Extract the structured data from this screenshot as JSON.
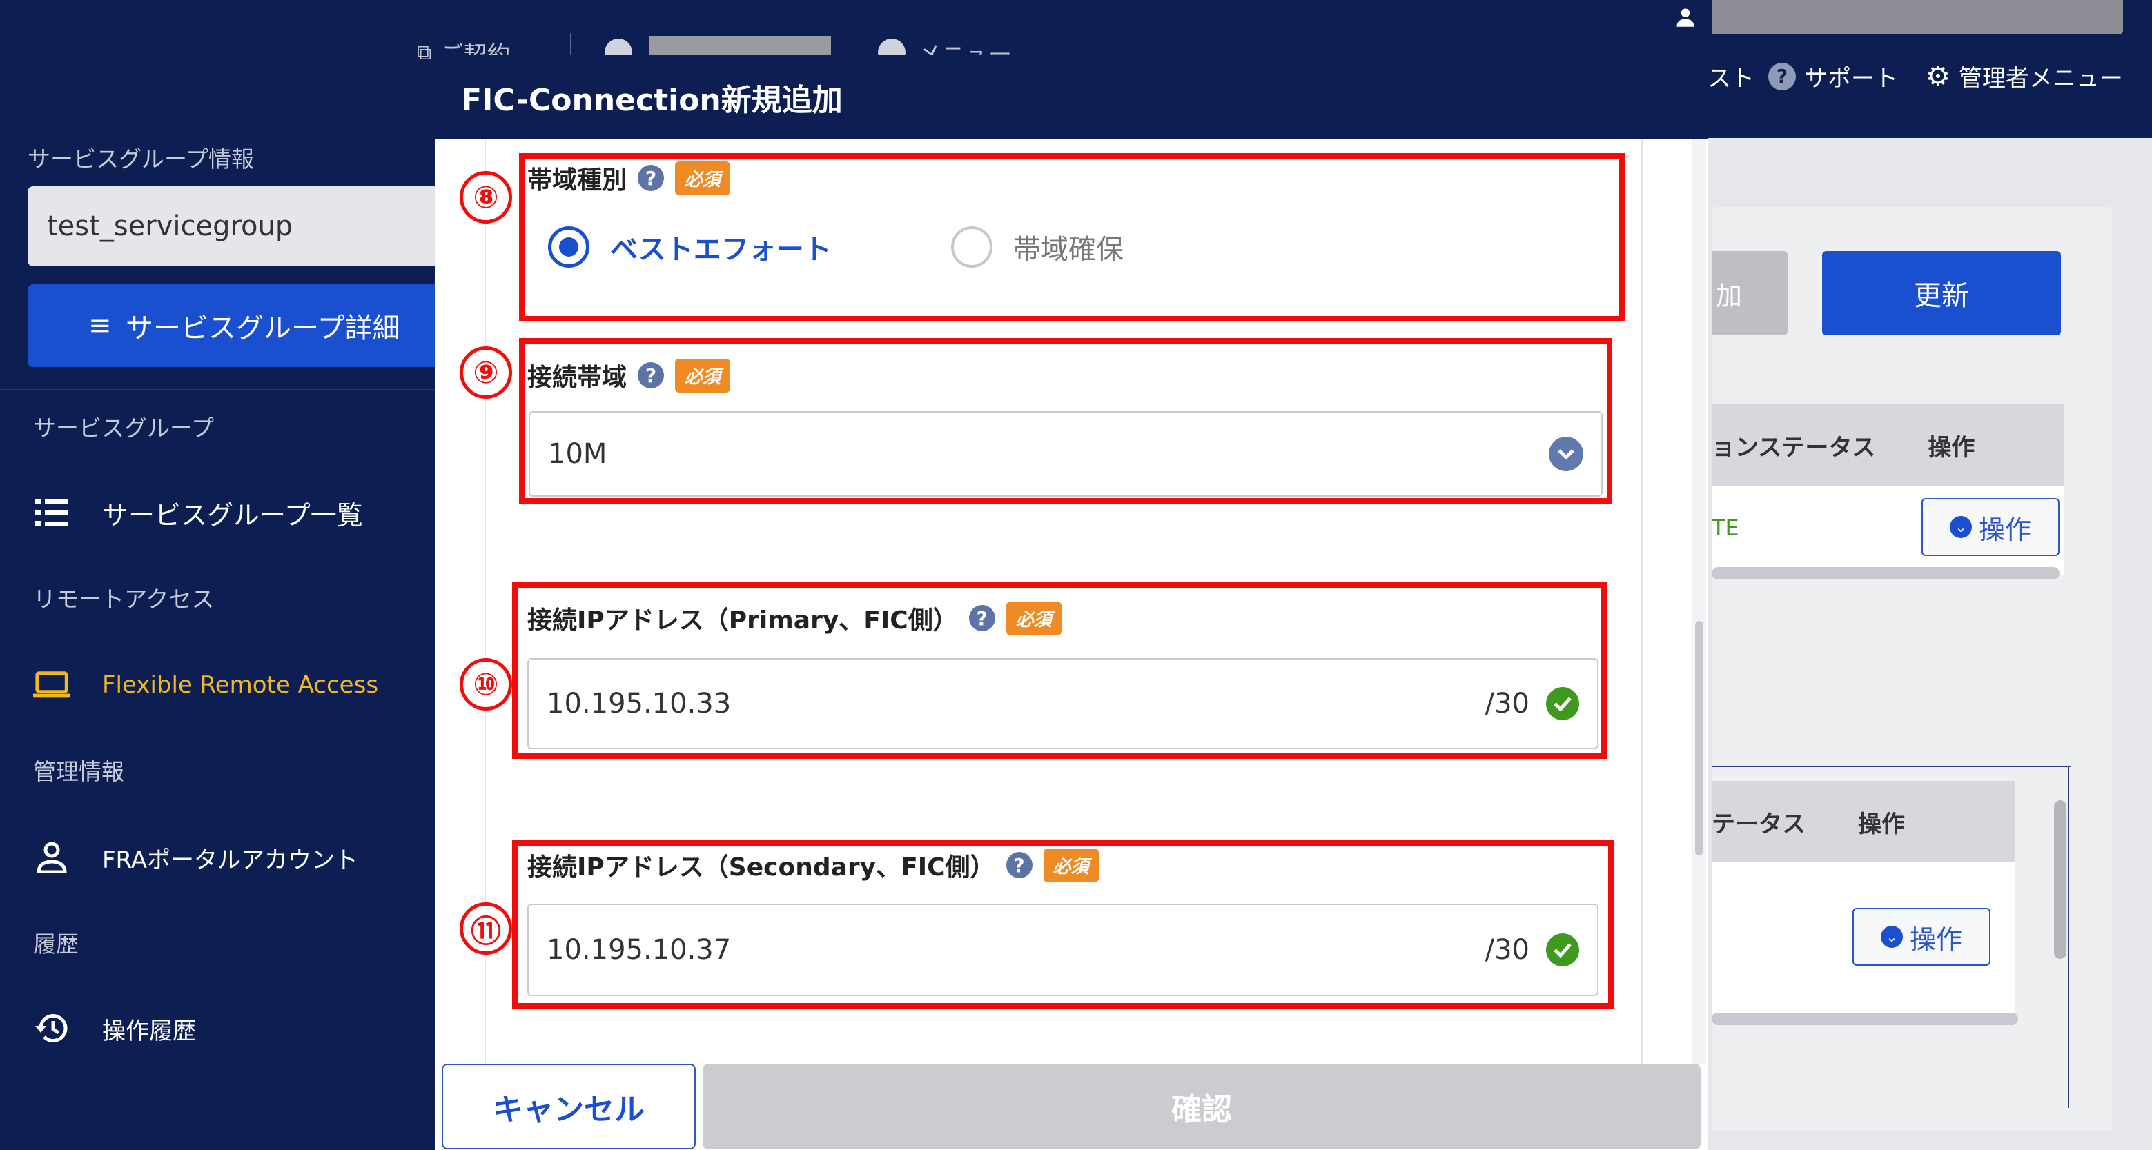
{
  "header": {
    "tab_contract": "ご契約",
    "tab_masked": "",
    "tab_menu": "メニュー",
    "tab_list": "スト",
    "support": "サポート",
    "admin_menu": "管理者メニュー"
  },
  "sidebar": {
    "group_info_title": "サービスグループ情報",
    "group_select_value": "test_servicegroup",
    "group_detail_button": "サービスグループ詳細",
    "sections": [
      {
        "title": "サービスグループ",
        "items": [
          {
            "label": "サービスグループ一覧",
            "icon": "list-icon"
          }
        ]
      },
      {
        "title": "リモートアクセス",
        "items": [
          {
            "label": "Flexible Remote Access",
            "icon": "laptop-icon"
          }
        ]
      },
      {
        "title": "管理情報",
        "items": [
          {
            "label": "FRAポータルアカウント",
            "icon": "person-icon"
          }
        ]
      },
      {
        "title": "履歴",
        "items": [
          {
            "label": "操作履歴",
            "icon": "history-icon"
          }
        ]
      }
    ]
  },
  "background": {
    "add_button": "加",
    "update_button": "更新",
    "table1": {
      "col_status": "ョンステータス",
      "col_action": "操作",
      "row_status": "TE",
      "row_action": "操作"
    },
    "table2": {
      "col_status": "テータス",
      "col_action": "操作",
      "row_action": "操作"
    }
  },
  "modal": {
    "title": "FIC-Connection新規追加",
    "required_badge": "必須",
    "bandwidth_type": {
      "number": "⑧",
      "label": "帯域種別",
      "options": [
        {
          "label": "ベストエフォート",
          "selected": true
        },
        {
          "label": "帯域確保",
          "selected": false
        }
      ]
    },
    "connection_bandwidth": {
      "number": "⑨",
      "label": "接続帯域",
      "value": "10M"
    },
    "ip_primary": {
      "number": "⑩",
      "label": "接続IPアドレス（Primary、FIC側）",
      "value": "10.195.10.33",
      "suffix": "/30"
    },
    "ip_secondary": {
      "number": "⑪",
      "label": "接続IPアドレス（Secondary、FIC側）",
      "value": "10.195.10.37",
      "suffix": "/30"
    },
    "cancel_button": "キャンセル",
    "confirm_button": "確認"
  },
  "colors": {
    "navy": "#0d1f52",
    "primary_blue": "#1a4fcf",
    "highlight_red": "#f20d0d",
    "required_orange": "#f08a24",
    "valid_green": "#3d9a1f",
    "accent_yellow": "#f2b81d"
  }
}
